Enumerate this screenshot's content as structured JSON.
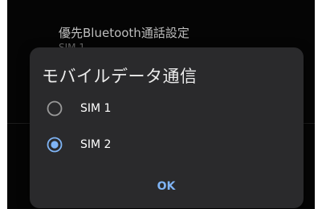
{
  "background_setting": {
    "title": "優先Bluetooth通話設定",
    "subtitle": "SIM 1"
  },
  "dialog": {
    "title": "モバイルデータ通信",
    "options": [
      {
        "label": "SIM 1",
        "selected": false
      },
      {
        "label": "SIM 2",
        "selected": true
      }
    ],
    "ok_label": "OK"
  },
  "colors": {
    "accent": "#7fb4f5",
    "dialog_bg": "#2a2a2c",
    "panel_bg": "#050505"
  },
  "icons": {
    "unselected": "radio-unchecked-icon",
    "selected": "radio-checked-icon"
  }
}
